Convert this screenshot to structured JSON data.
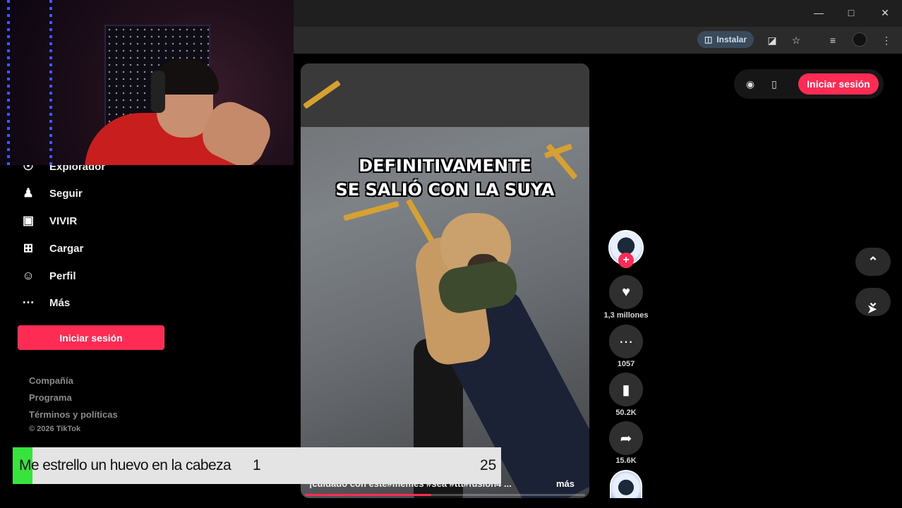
{
  "browser": {
    "install_label": "Instalar",
    "window_controls": [
      "minimize-icon",
      "maximize-icon",
      "close-icon"
    ],
    "toolbar_icons": [
      "translate-icon",
      "star-icon",
      "media-icon",
      "menu-icon"
    ]
  },
  "sidebar": {
    "items": [
      {
        "label": "Explorador",
        "icon": "explore-icon"
      },
      {
        "label": "Seguir",
        "icon": "follow-icon"
      },
      {
        "label": "VIVIR",
        "icon": "live-icon"
      },
      {
        "label": "Cargar",
        "icon": "upload-icon"
      },
      {
        "label": "Perfil",
        "icon": "profile-icon"
      },
      {
        "label": "Más",
        "icon": "more-icon"
      }
    ],
    "login_label": "Iniciar sesión",
    "footer": [
      "Compañía",
      "Programa",
      "Términos y políticas",
      "© 2026 TikTok"
    ]
  },
  "video": {
    "caption_line1": "DEFINITIVAMENTE",
    "caption_line2": "SE SALIÓ CON LA SUYA",
    "description": "¡cuidado con este#memes #sea #ttt#fusión4 ...",
    "more_label": "más",
    "progress": 0.45
  },
  "actions": {
    "likes": "1,3 millones",
    "comments": "1057",
    "saves": "50.2K",
    "shares": "15.6K"
  },
  "top_right": {
    "login_label": "Iniciar sesión"
  },
  "poll": {
    "text": "Me estrello un huevo en la cabeza",
    "count_a": "1",
    "count_b": "25",
    "fill_fraction": 0.04
  },
  "colors": {
    "accent": "#fe2c55",
    "poll_green": "#37e33c",
    "background": "#000000"
  }
}
